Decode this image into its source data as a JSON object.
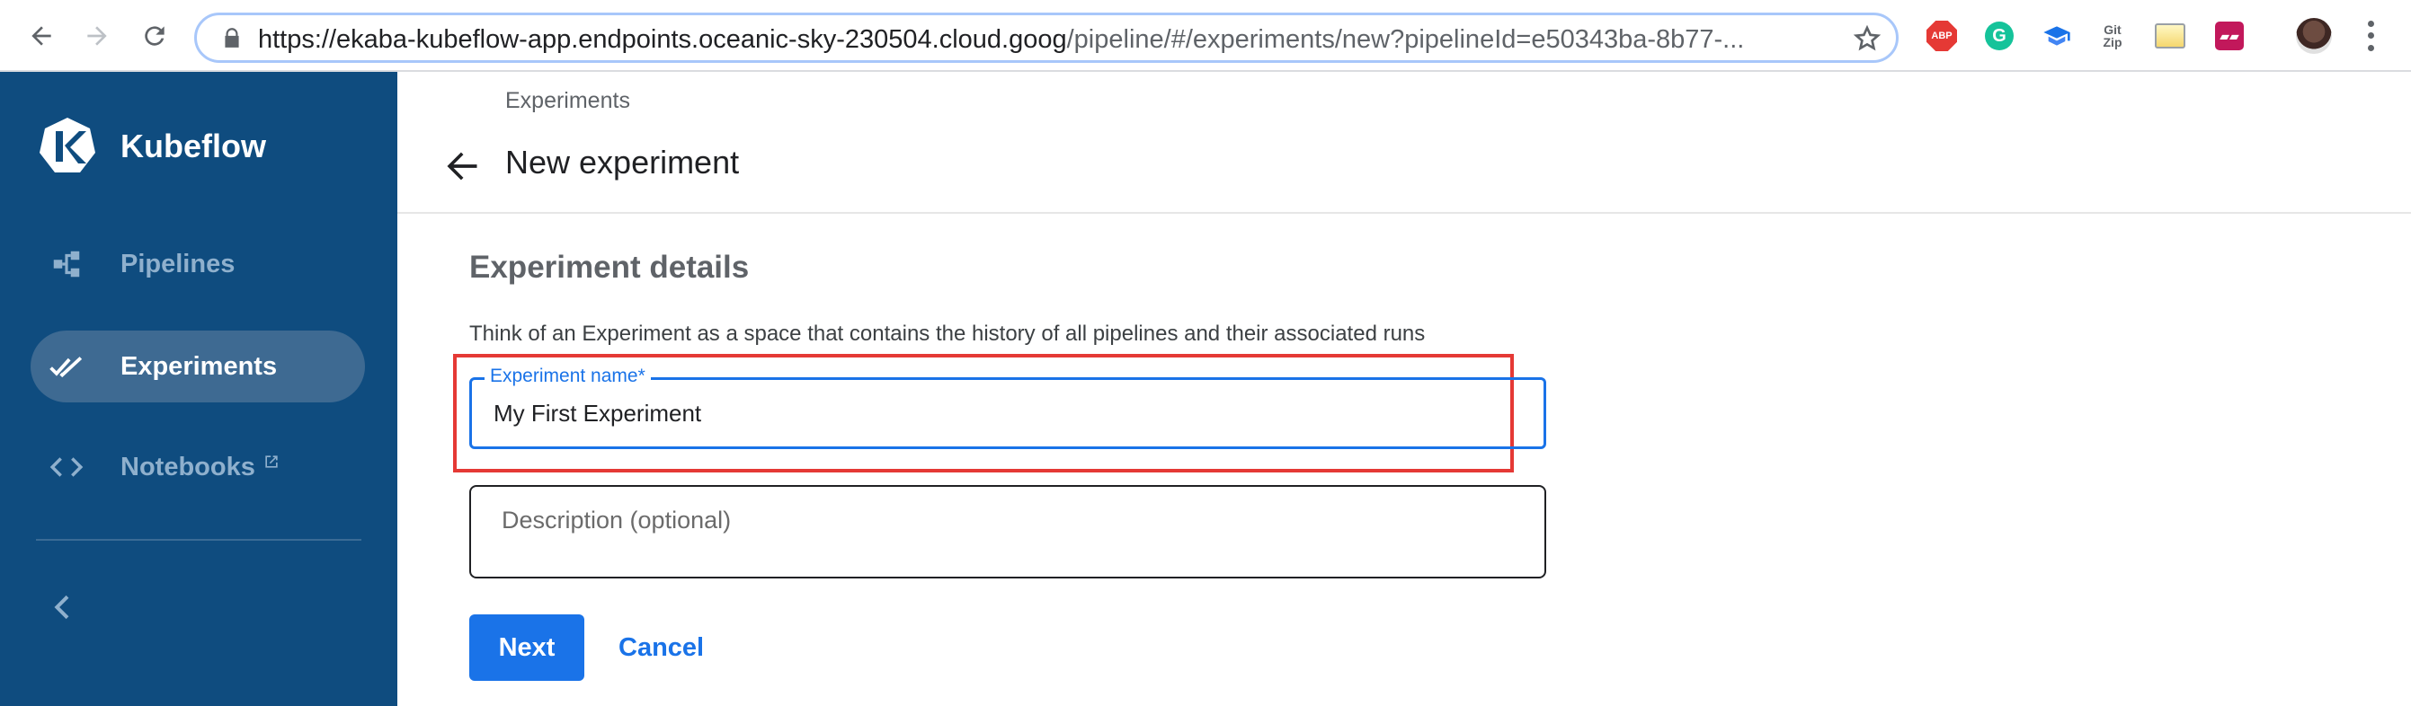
{
  "browser": {
    "url_host": "https://ekaba-kubeflow-app.endpoints.oceanic-sky-230504.cloud.goog",
    "url_path": "/pipeline/#/experiments/new?pipelineId=e50343ba-8b77-...",
    "extensions": [
      {
        "name": "adblock-plus-icon",
        "text": "ABP"
      },
      {
        "name": "grammarly-icon",
        "text": "G"
      },
      {
        "name": "graduation-cap-icon",
        "text": ""
      },
      {
        "name": "gitzip-icon",
        "text": "Git\nZip"
      },
      {
        "name": "image-extension-icon",
        "text": ""
      },
      {
        "name": "mendeley-icon",
        "text": ""
      }
    ],
    "accent": "#1a73e8"
  },
  "sidebar": {
    "brand": "Kubeflow",
    "items": [
      {
        "label": "Pipelines",
        "icon": "pipelines-icon",
        "active": false
      },
      {
        "label": "Experiments",
        "icon": "double-check-icon",
        "active": true
      },
      {
        "label": "Notebooks",
        "icon": "code-brackets-icon",
        "active": false,
        "external": true
      }
    ],
    "background": "#0f4c7f"
  },
  "header": {
    "breadcrumb": "Experiments",
    "title": "New experiment"
  },
  "form": {
    "section_title": "Experiment details",
    "section_description": "Think of an Experiment as a space that contains the history of all pipelines and their associated runs",
    "name_label": "Experiment name",
    "name_required_mark": "*",
    "name_value": "My First Experiment",
    "description_placeholder": "Description (optional)",
    "highlight_color": "#e53935"
  },
  "actions": {
    "next_label": "Next",
    "cancel_label": "Cancel"
  }
}
